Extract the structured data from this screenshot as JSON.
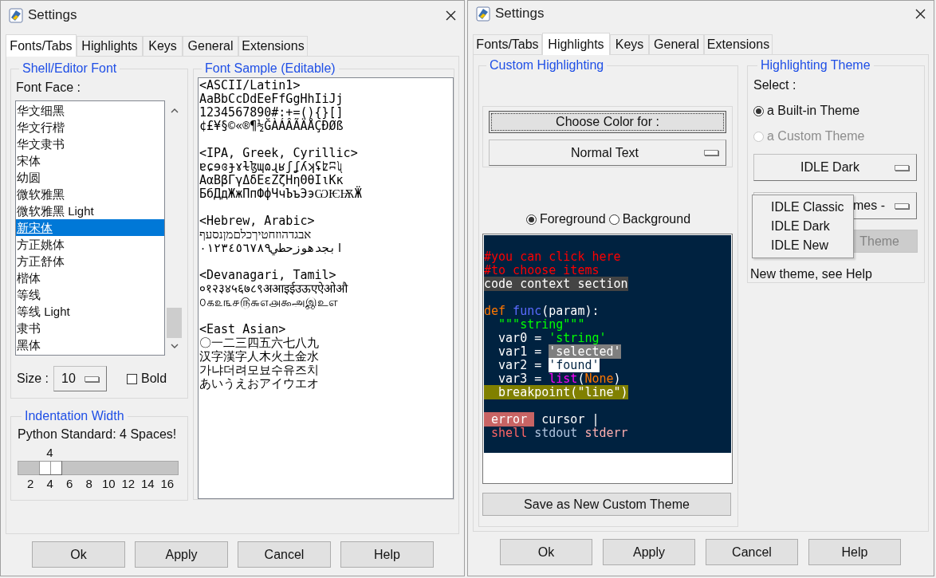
{
  "left_window": {
    "title": "Settings",
    "tabs": [
      {
        "label": "Fonts/Tabs",
        "selected": true
      },
      {
        "label": "Highlights",
        "selected": false
      },
      {
        "label": "Keys",
        "selected": false
      },
      {
        "label": "General",
        "selected": false
      },
      {
        "label": "Extensions",
        "selected": false
      }
    ],
    "font_group": {
      "title": "Shell/Editor Font",
      "label": "Font Face :",
      "fonts": [
        {
          "name": "华文细黑",
          "selected": false
        },
        {
          "name": "华文行楷",
          "selected": false
        },
        {
          "name": "华文隶书",
          "selected": false
        },
        {
          "name": "宋体",
          "selected": false
        },
        {
          "name": "幼圆",
          "selected": false
        },
        {
          "name": "微软雅黑",
          "selected": false
        },
        {
          "name": "微软雅黑 Light",
          "selected": false
        },
        {
          "name": "新宋体",
          "selected": true
        },
        {
          "name": "方正姚体",
          "selected": false
        },
        {
          "name": "方正舒体",
          "selected": false
        },
        {
          "name": "楷体",
          "selected": false
        },
        {
          "name": "等线",
          "selected": false
        },
        {
          "name": "等线 Light",
          "selected": false
        },
        {
          "name": "隶书",
          "selected": false
        },
        {
          "name": "黑体",
          "selected": false
        }
      ],
      "size_label": "Size :",
      "size": "10",
      "bold": {
        "label": "Bold",
        "checked": false
      }
    },
    "sample_group": {
      "title": "Font Sample (Editable)",
      "sections": [
        {
          "lines": [
            "<ASCII/Latin1>",
            "AaBbCcDdEeFfGgHhIiJj",
            "1234567890#:+=(){}[]",
            "¢£¥§©«®¶½ĞÀÁÂÃÄÅÇÐØß"
          ]
        },
        {
          "lines": [
            "<IPA, Greek, Cyrillic>",
            "ɐɕɘɞɟɤɫɮɰɷɻʁʃʆʎʞʢʫʭʯ",
            "ΑαΒβΓγΔδΕεΖζΗηΘθΙιΚκ",
            "БбДдЖжПпФфЧчЪъЭэѠѤѬӜ"
          ]
        },
        {
          "lines": [
            "<Hebrew, Arabic>",
            "אבגדהוזחטיךכלםמןנסעף",
            "ابجدهوزحطي٠١٢٣٤٥٦٧٨٩"
          ]
        },
        {
          "lines": [
            "<Devanagari, Tamil>",
            "०१२३४५६७८९अआइईउऊएऐओऔ",
            "௦௧௨௩௪௫௬௭௮௯அஇஉஎ"
          ]
        },
        {
          "lines": [
            "<East Asian>",
            "〇一二三四五六七八九",
            "汉字漢字人木火土金水",
            "가냐더려모뵤수유즈치",
            "あいうえおアイウエオ"
          ]
        }
      ]
    },
    "indent_group": {
      "title": "Indentation Width",
      "description": "Python Standard: 4 Spaces!",
      "value": "4",
      "level": 0.15,
      "ticks": [
        "2",
        "4",
        "6",
        "8",
        "10",
        "12",
        "14",
        "16"
      ]
    },
    "buttons": [
      "Ok",
      "Apply",
      "Cancel",
      "Help"
    ]
  },
  "right_window": {
    "title": "Settings",
    "tabs": [
      {
        "label": "Fonts/Tabs",
        "selected": false
      },
      {
        "label": "Highlights",
        "selected": true
      },
      {
        "label": "Keys",
        "selected": false
      },
      {
        "label": "General",
        "selected": false
      },
      {
        "label": "Extensions",
        "selected": false
      }
    ],
    "custom_group": {
      "title": "Custom Highlighting",
      "choose_button": "Choose Color for :",
      "element_dropdown": "Normal Text",
      "target_options": [
        {
          "label": "Foreground",
          "selected": true
        },
        {
          "label": "Background",
          "selected": false
        }
      ],
      "code_sample": {
        "blocks": [
          {
            "lines": [
              [
                {
                  "text": "#you can click here",
                  "kind": "comment"
                }
              ],
              [
                {
                  "text": "#to choose items",
                  "kind": "comment"
                }
              ],
              [
                {
                  "text": "code context section",
                  "kind": "context"
                }
              ]
            ]
          },
          {
            "lines": [
              [
                {
                  "text": "def",
                  "kind": "keyword"
                },
                {
                  "text": " func",
                  "kind": "definition"
                },
                {
                  "text": "(param):",
                  "kind": "normal"
                }
              ],
              [
                {
                  "text": "  \"\"\"string\"\"\"",
                  "kind": "string"
                }
              ],
              [
                {
                  "text": "  var0 = ",
                  "kind": "normal"
                },
                {
                  "text": "'string'",
                  "kind": "string"
                }
              ],
              [
                {
                  "text": "  var1 = ",
                  "kind": "normal"
                },
                {
                  "text": "'selected'",
                  "kind": "selected"
                }
              ],
              [
                {
                  "text": "  var2 = ",
                  "kind": "normal"
                },
                {
                  "text": "'found'",
                  "kind": "found"
                }
              ],
              [
                {
                  "text": "  var3 = ",
                  "kind": "normal"
                },
                {
                  "text": "list",
                  "kind": "builtin"
                },
                {
                  "text": "(",
                  "kind": "normal"
                },
                {
                  "text": "None",
                  "kind": "keyword"
                },
                {
                  "text": ")",
                  "kind": "normal"
                }
              ],
              [
                {
                  "text": "  breakpoint(\"line\")",
                  "kind": "breakpoint"
                }
              ]
            ]
          },
          {
            "lines": [
              [
                {
                  "text": " error ",
                  "kind": "error"
                },
                {
                  "text": " cursor |",
                  "kind": "normal"
                }
              ],
              [
                {
                  "text": " shell",
                  "kind": "console"
                },
                {
                  "text": " stdout",
                  "kind": "stdout"
                },
                {
                  "text": " stderr",
                  "kind": "stderr"
                }
              ]
            ]
          }
        ]
      },
      "save_button": "Save as New Custom Theme"
    },
    "theme_group": {
      "title": "Highlighting Theme",
      "select_label": "Select :",
      "theme_types": [
        {
          "label": "a Built-in Theme",
          "selected": true,
          "disabled": false
        },
        {
          "label": "a Custom Theme",
          "selected": false,
          "disabled": true
        }
      ],
      "builtin_dropdown": "IDLE Dark",
      "custom_dropdown": "mes -",
      "delete_button": {
        "label": "Theme",
        "disabled": true
      },
      "menu": [
        {
          "label": "IDLE Classic"
        },
        {
          "label": "IDLE Dark"
        },
        {
          "label": "IDLE New"
        }
      ],
      "note": "New theme, see Help"
    },
    "buttons": [
      "Ok",
      "Apply",
      "Cancel",
      "Help"
    ]
  }
}
